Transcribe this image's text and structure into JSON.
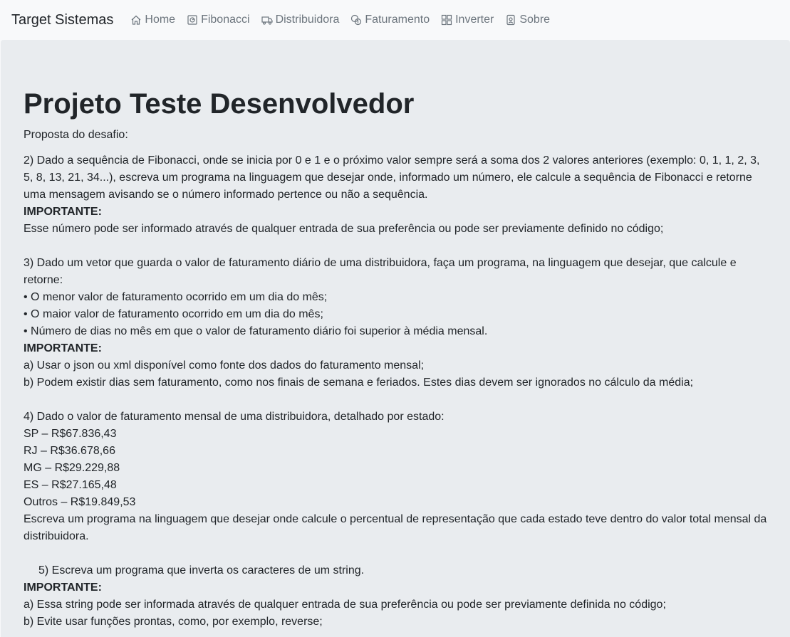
{
  "navbar": {
    "brand": "Target Sistemas",
    "links": [
      {
        "label": "Home",
        "icon": "home-icon"
      },
      {
        "label": "Fibonacci",
        "icon": "fibonacci-icon"
      },
      {
        "label": "Distribuidora",
        "icon": "truck-icon"
      },
      {
        "label": "Faturamento",
        "icon": "coins-icon"
      },
      {
        "label": "Inverter",
        "icon": "grid-icon"
      },
      {
        "label": "Sobre",
        "icon": "person-badge-icon"
      }
    ]
  },
  "main": {
    "title": "Projeto Teste Desenvolvedor",
    "lead": "Proposta do desafio:",
    "important_label": "IMPORTANTE:",
    "q2": {
      "text": "2) Dado a sequência de Fibonacci, onde se inicia por 0 e 1 e o próximo valor sempre será a soma dos 2 valores anteriores (exemplo: 0, 1, 1, 2, 3, 5, 8, 13, 21, 34...), escreva um programa na linguagem que desejar onde, informado um número, ele calcule a sequência de Fibonacci e retorne uma mensagem avisando se o número informado pertence ou não a sequência.",
      "note": "Esse número pode ser informado através de qualquer entrada de sua preferência ou pode ser previamente definido no código;"
    },
    "q3": {
      "text": "3) Dado um vetor que guarda o valor de faturamento diário de uma distribuidora, faça um programa, na linguagem que desejar, que calcule e retorne:",
      "bullets": [
        "• O menor valor de faturamento ocorrido em um dia do mês;",
        "• O maior valor de faturamento ocorrido em um dia do mês;",
        "• Número de dias no mês em que o valor de faturamento diário foi superior à média mensal."
      ],
      "notes": [
        "a) Usar o json ou xml disponível como fonte dos dados do faturamento mensal;",
        "b) Podem existir dias sem faturamento, como nos finais de semana e feriados. Estes dias devem ser ignorados no cálculo da média;"
      ]
    },
    "q4": {
      "text": "4) Dado o valor de faturamento mensal de uma distribuidora, detalhado por estado:",
      "states": [
        "SP – R$67.836,43",
        "RJ – R$36.678,66",
        "MG – R$29.229,88",
        "ES – R$27.165,48",
        "Outros – R$19.849,53"
      ],
      "closing": "Escreva um programa na linguagem que desejar onde calcule o percentual de representação que cada estado teve dentro do valor total mensal da distribuidora."
    },
    "q5": {
      "text": "5) Escreva um programa que inverta os caracteres de um string.",
      "notes": [
        "a) Essa string pode ser informada através de qualquer entrada de sua preferência ou pode ser previamente definida no código;",
        "b) Evite usar funções prontas, como, por exemplo, reverse;"
      ]
    }
  }
}
